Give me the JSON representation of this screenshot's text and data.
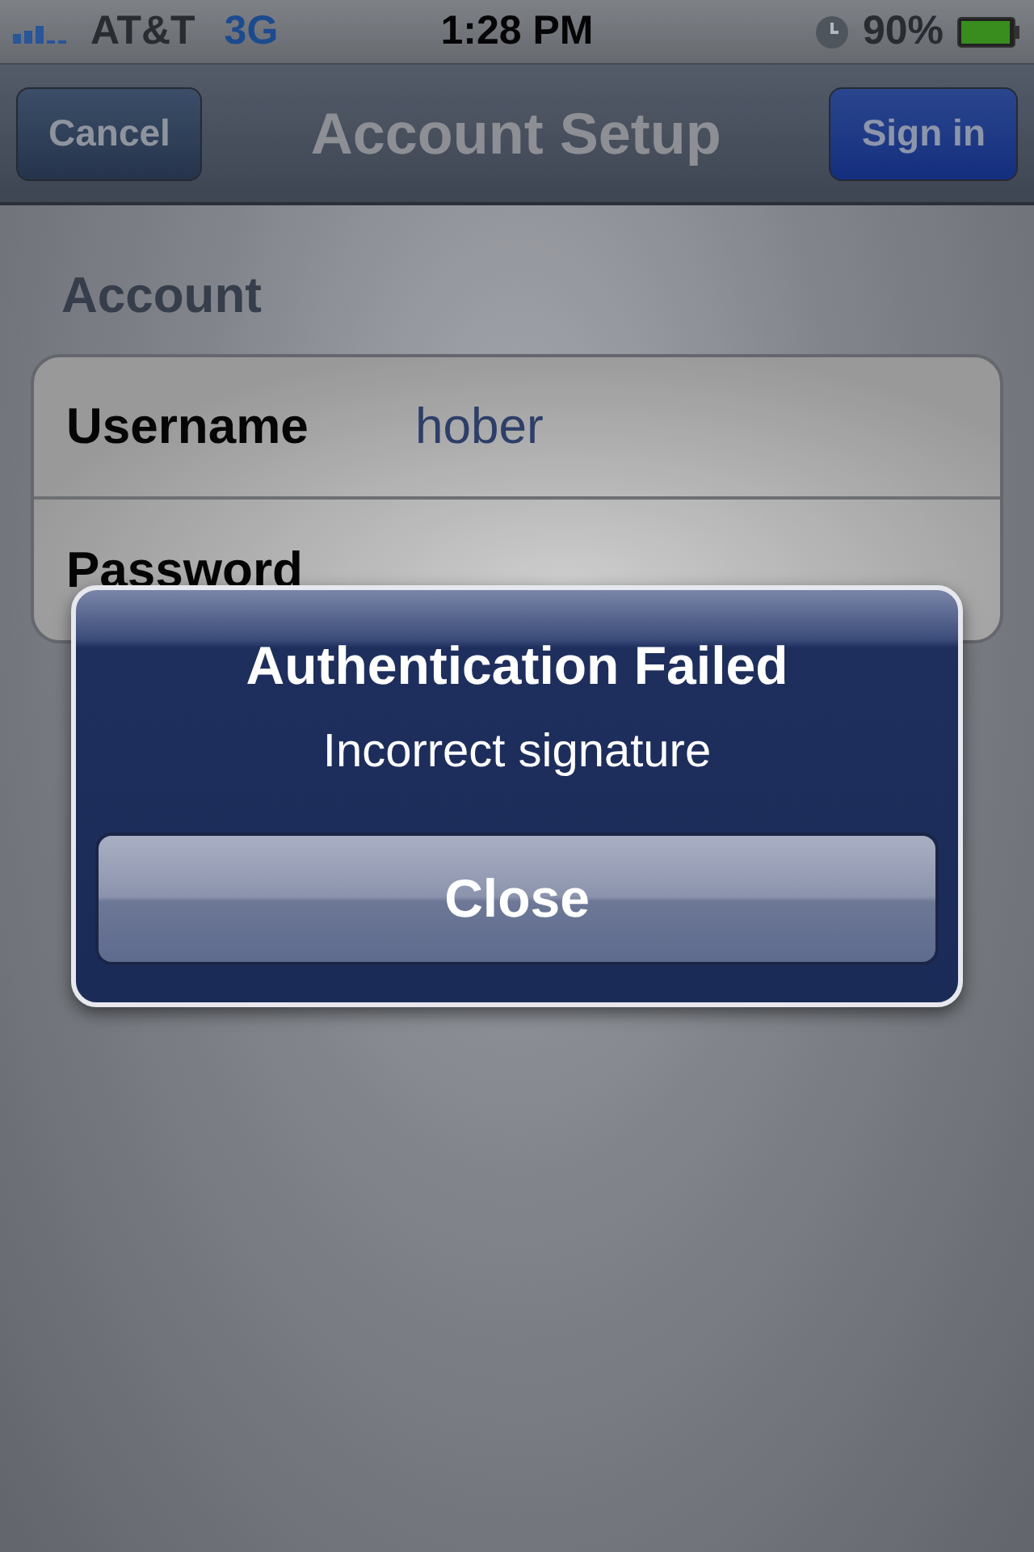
{
  "status_bar": {
    "carrier": "AT&T",
    "network": "3G",
    "time": "1:28 PM",
    "battery_percent": "90%"
  },
  "nav_bar": {
    "title": "Account Setup",
    "left_button": "Cancel",
    "right_button": "Sign in"
  },
  "section": {
    "header": "Account",
    "rows": [
      {
        "label": "Username",
        "value": "hober"
      },
      {
        "label": "Password",
        "value": ""
      }
    ]
  },
  "alert": {
    "title": "Authentication Failed",
    "message": "Incorrect signature",
    "button": "Close"
  }
}
